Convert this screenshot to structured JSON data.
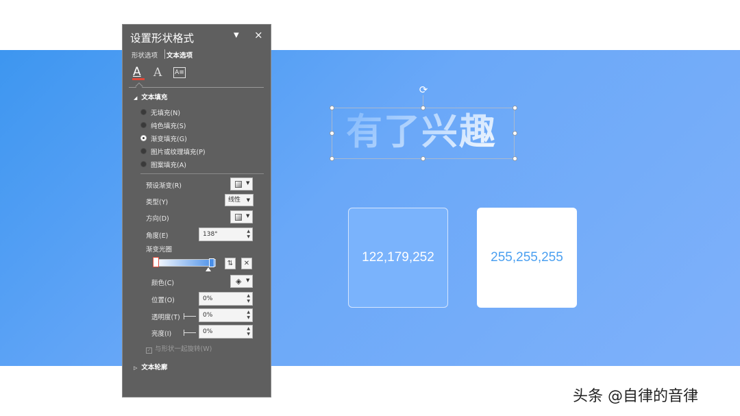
{
  "slide": {
    "hero_text": "有了兴趣",
    "swatches": [
      {
        "label": "122,179,252",
        "color": "#7ab3fc"
      },
      {
        "label": "255,255,255",
        "color": "#ffffff"
      }
    ],
    "watermark": "头条 @自律的音律",
    "band_colors": [
      "#3d96f0",
      "#7fb1fa"
    ]
  },
  "pane": {
    "title": "设置形状格式",
    "pin_icon": "dropdown-triangle",
    "close_icon": "×",
    "tabs": [
      "形状选项",
      "文本选项"
    ],
    "active_tab": "文本选项",
    "icon_tabs": [
      "text-fill-outline-icon",
      "text-effects-icon",
      "textbox-icon"
    ],
    "text_fill": {
      "header": "文本填充",
      "options": [
        {
          "label": "无填充(N)",
          "selected": false
        },
        {
          "label": "纯色填充(S)",
          "selected": false
        },
        {
          "label": "渐变填充(G)",
          "selected": true
        },
        {
          "label": "图片或纹理填充(P)",
          "selected": false
        },
        {
          "label": "图案填充(A)",
          "selected": false
        }
      ]
    },
    "gradient": {
      "preset_label": "预设渐变(R)",
      "type_label": "类型(Y)",
      "type_value": "线性",
      "direction_label": "方向(D)",
      "angle_label": "角度(E)",
      "angle_value": "138°",
      "stops_label": "渐变光圈",
      "color_label": "颜色(C)",
      "position_label": "位置(O)",
      "position_value": "0%",
      "transparency_label": "透明度(T)",
      "transparency_value": "0%",
      "brightness_label": "亮度(I)",
      "brightness_value": "0%",
      "rotate_with_shape_label": "与形状一起旋转(W)",
      "stop_colors": [
        "#ffffff",
        "#4a8fe8"
      ]
    },
    "text_outline": {
      "header": "文本轮廓"
    }
  }
}
